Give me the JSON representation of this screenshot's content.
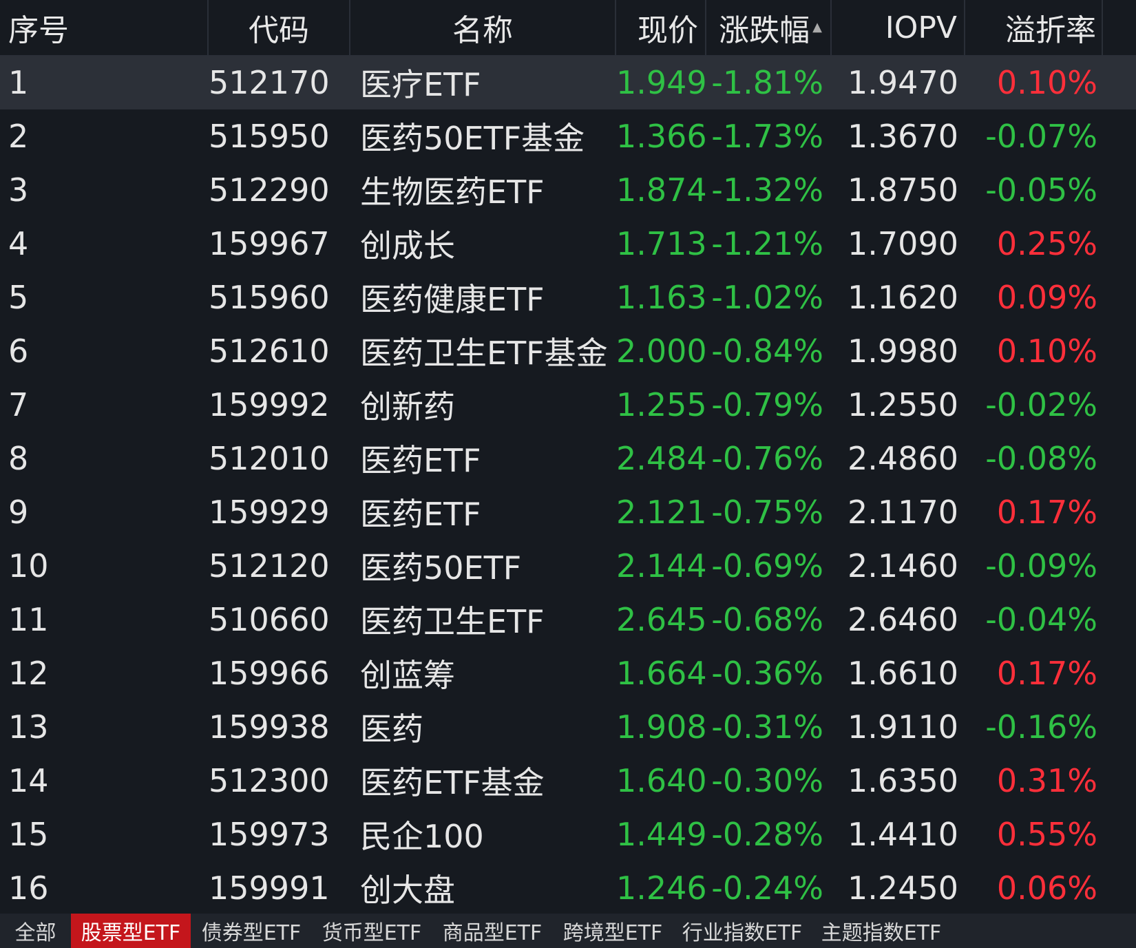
{
  "colors": {
    "background": "#161a20",
    "selected_row": "#2c3038",
    "up": "#ff2f3a",
    "down": "#2fc145",
    "active_tab": "#c4161c",
    "tab_bar": "#20242b"
  },
  "table": {
    "columns": [
      "序号",
      "代码",
      "名称",
      "现价",
      "涨跌幅",
      "IOPV",
      "溢折率"
    ],
    "sort": {
      "column": "涨跌幅",
      "direction": "ascending",
      "icon": "sort-up-icon"
    },
    "selected_row": 1,
    "rows": [
      {
        "no": "1",
        "code": "512170",
        "name": "医疗ETF",
        "price": "1.949",
        "change": "-1.81%",
        "iopv": "1.9470",
        "premium": "0.10%"
      },
      {
        "no": "2",
        "code": "515950",
        "name": "医药50ETF基金",
        "price": "1.366",
        "change": "-1.73%",
        "iopv": "1.3670",
        "premium": "-0.07%"
      },
      {
        "no": "3",
        "code": "512290",
        "name": "生物医药ETF",
        "price": "1.874",
        "change": "-1.32%",
        "iopv": "1.8750",
        "premium": "-0.05%"
      },
      {
        "no": "4",
        "code": "159967",
        "name": "创成长",
        "price": "1.713",
        "change": "-1.21%",
        "iopv": "1.7090",
        "premium": "0.25%"
      },
      {
        "no": "5",
        "code": "515960",
        "name": "医药健康ETF",
        "price": "1.163",
        "change": "-1.02%",
        "iopv": "1.1620",
        "premium": "0.09%"
      },
      {
        "no": "6",
        "code": "512610",
        "name": "医药卫生ETF基金",
        "price": "2.000",
        "change": "-0.84%",
        "iopv": "1.9980",
        "premium": "0.10%"
      },
      {
        "no": "7",
        "code": "159992",
        "name": "创新药",
        "price": "1.255",
        "change": "-0.79%",
        "iopv": "1.2550",
        "premium": "-0.02%"
      },
      {
        "no": "8",
        "code": "512010",
        "name": "医药ETF",
        "price": "2.484",
        "change": "-0.76%",
        "iopv": "2.4860",
        "premium": "-0.08%"
      },
      {
        "no": "9",
        "code": "159929",
        "name": "医药ETF",
        "price": "2.121",
        "change": "-0.75%",
        "iopv": "2.1170",
        "premium": "0.17%"
      },
      {
        "no": "10",
        "code": "512120",
        "name": "医药50ETF",
        "price": "2.144",
        "change": "-0.69%",
        "iopv": "2.1460",
        "premium": "-0.09%"
      },
      {
        "no": "11",
        "code": "510660",
        "name": "医药卫生ETF",
        "price": "2.645",
        "change": "-0.68%",
        "iopv": "2.6460",
        "premium": "-0.04%"
      },
      {
        "no": "12",
        "code": "159966",
        "name": "创蓝筹",
        "price": "1.664",
        "change": "-0.36%",
        "iopv": "1.6610",
        "premium": "0.17%"
      },
      {
        "no": "13",
        "code": "159938",
        "name": "医药",
        "price": "1.908",
        "change": "-0.31%",
        "iopv": "1.9110",
        "premium": "-0.16%"
      },
      {
        "no": "14",
        "code": "512300",
        "name": "医药ETF基金",
        "price": "1.640",
        "change": "-0.30%",
        "iopv": "1.6350",
        "premium": "0.31%"
      },
      {
        "no": "15",
        "code": "159973",
        "name": "民企100",
        "price": "1.449",
        "change": "-0.28%",
        "iopv": "1.4410",
        "premium": "0.55%"
      },
      {
        "no": "16",
        "code": "159991",
        "name": "创大盘",
        "price": "1.246",
        "change": "-0.24%",
        "iopv": "1.2450",
        "premium": "0.06%"
      }
    ]
  },
  "tabs": {
    "items": [
      "全部",
      "股票型ETF",
      "债券型ETF",
      "货币型ETF",
      "商品型ETF",
      "跨境型ETF",
      "行业指数ETF",
      "主题指数ETF"
    ],
    "active": "股票型ETF"
  }
}
